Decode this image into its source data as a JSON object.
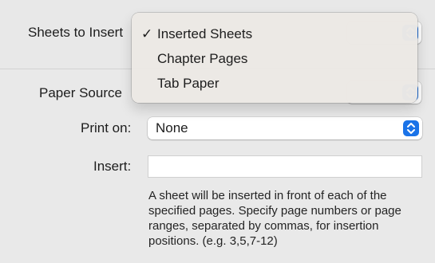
{
  "form": {
    "sheets_to_insert_label": "Sheets to Insert",
    "paper_source_label": "Paper Source",
    "print_on_label": "Print on:",
    "print_on_value": "None",
    "insert_label": "Insert:",
    "insert_value": "",
    "help_text": "A sheet will be inserted in front of each of the specified pages. Specify page numbers or page ranges, separated by commas, for insertion positions. (e.g. 3,5,7-12)"
  },
  "menu": {
    "items": [
      {
        "label": "Inserted Sheets",
        "checkmark": "✓",
        "selected": true
      },
      {
        "label": "Chapter Pages",
        "checkmark": "",
        "selected": false
      },
      {
        "label": "Tab Paper",
        "checkmark": "",
        "selected": false
      }
    ]
  },
  "colors": {
    "accent": "#1a73e8",
    "panel_background": "#e9e9e9",
    "menu_background": "#ece9e4"
  }
}
